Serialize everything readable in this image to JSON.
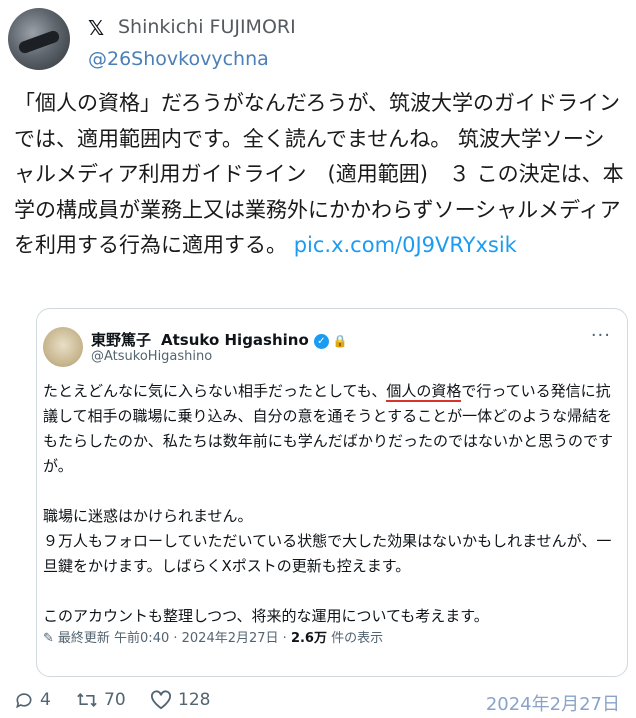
{
  "author": {
    "display_name": "Shinkichi FUJIMORI",
    "handle": "@26Shovkovychna"
  },
  "tweet": {
    "text": "「個人の資格」だろうがなんだろうが、筑波大学のガイドラインでは、適用範囲内です。全く読んでませんね。 筑波大学ソーシャルメディア利用ガイドライン　(適用範囲)　３ この決定は、本学の構成員が業務上又は業務外にかかわらずソーシャルメディアを利用する行為に適用する。 ",
    "link": "pic.x.com/0J9VRYxsik"
  },
  "quoted": {
    "name_ja": "東野篤子",
    "name_en": "Atsuko Higashino",
    "handle": "@AtsukoHigashino",
    "para1_before": "たとえどんなに気に入らない相手だったとしても、",
    "para1_underlined": "個人の資格",
    "para1_after": "で行っている発信に抗議して相手の職場に乗り込み、自分の意を通そうとすることが一体どのような帰結をもたらしたのか、私たちは数年前にも学んだばかりだったのではないかと思うのですが。",
    "para2_line1": "職場に迷惑はかけられません。",
    "para2_line2": "９万人もフォローしていただいている状態で大した効果はないかもしれませんが、一旦鍵をかけます。しばらくXポストの更新も控えます。",
    "para3": "このアカウントも整理しつつ、将来的な運用についても考えます。",
    "meta_prefix": "最終更新 午前0:40 · 2024年2月27日 · ",
    "meta_views": "2.6万",
    "meta_suffix": " 件の表示"
  },
  "actions": {
    "replies": "4",
    "retweets": "70",
    "likes": "128",
    "date": "2024年2月27日"
  },
  "colors": {
    "link": "#1d9bf0",
    "handle": "#4a7fb8",
    "underline": "#d9342b",
    "date": "#8aa3c7"
  }
}
